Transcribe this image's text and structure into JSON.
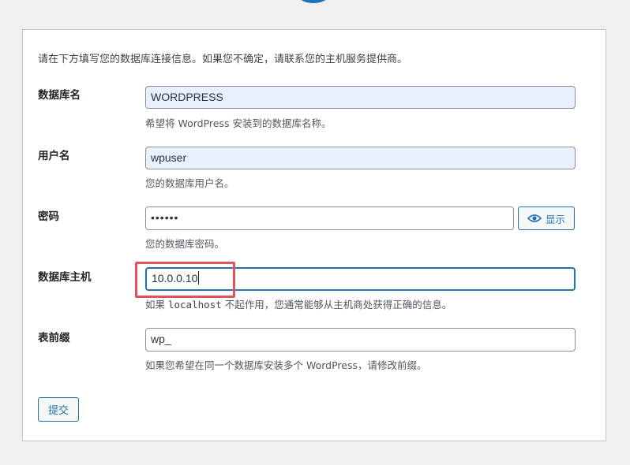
{
  "intro_text": "请在下方填写您的数据库连接信息。如果您不确定，请联系您的主机服务提供商。",
  "fields": {
    "dbname": {
      "label": "数据库名",
      "value": "WORDPRESS",
      "help": "希望将 WordPress 安装到的数据库名称。"
    },
    "username": {
      "label": "用户名",
      "value": "wpuser",
      "help": "您的数据库用户名。"
    },
    "password": {
      "label": "密码",
      "value": "••••••",
      "help": "您的数据库密码。",
      "toggle_label": "显示"
    },
    "dbhost": {
      "label": "数据库主机",
      "value": "10.0.0.10",
      "help_prefix": "如果 ",
      "help_code": "localhost",
      "help_suffix": " 不起作用，您通常能够从主机商处获得正确的信息。"
    },
    "prefix": {
      "label": "表前缀",
      "value": "wp_",
      "help": "如果您希望在同一个数据库安装多个 WordPress，请修改前缀。"
    }
  },
  "submit_label": "提交",
  "colors": {
    "accent": "#2271b1",
    "autofill_bg": "#e8f0fe",
    "highlight": "#e2525c",
    "page_bg": "#f0f0f1"
  },
  "icons": {
    "show_password": "eye-icon",
    "logo": "wordpress-logo"
  }
}
